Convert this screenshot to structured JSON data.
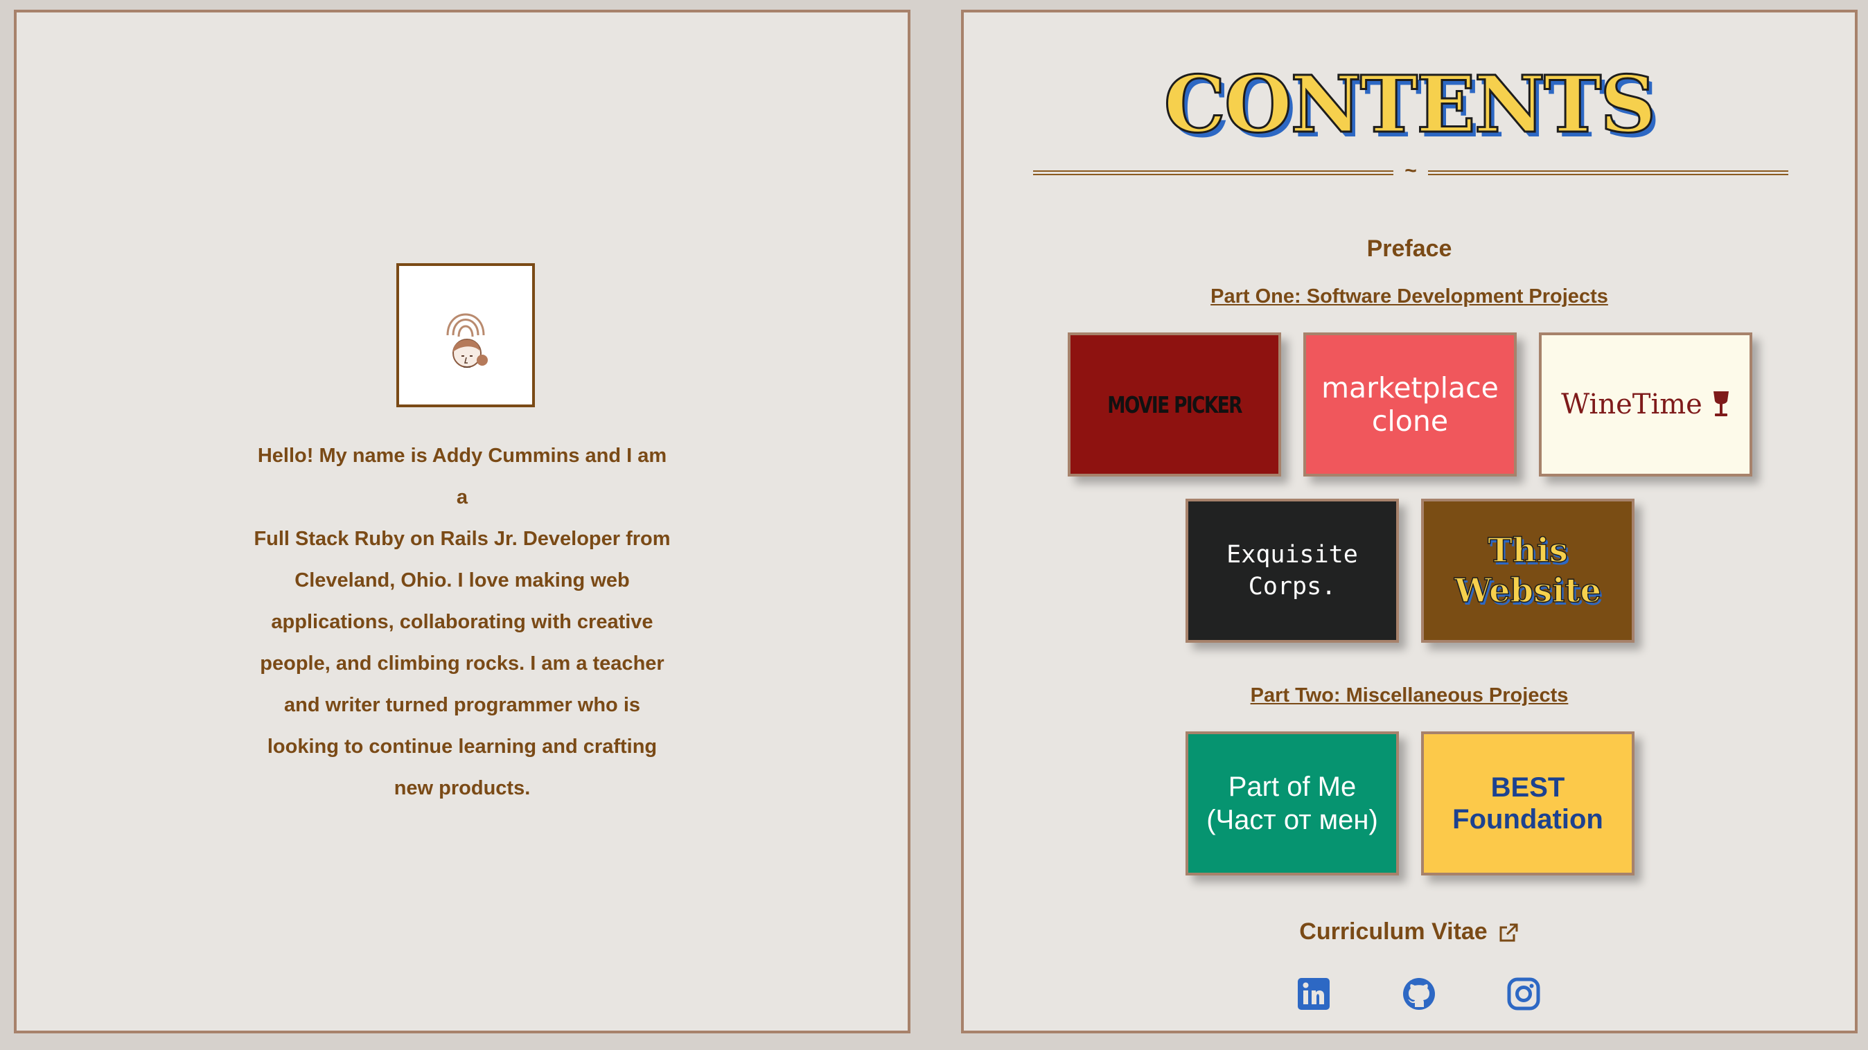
{
  "bio": {
    "lines": [
      "Hello! My name is Addy Cummins and I am a",
      "Full Stack Ruby on Rails Jr. Developer from",
      "Cleveland, Ohio. I love making web",
      "applications, collaborating with creative",
      "people, and climbing rocks. I am a teacher",
      "and writer turned programmer who is",
      "looking to continue learning and crafting",
      "new products."
    ],
    "avatar_icon": "face-with-rainbow-illustration"
  },
  "contents": {
    "title": "CONTENTS",
    "divider": "~",
    "preface": "Preface",
    "part_one": "Part One: Software Development Projects",
    "part_two": "Part Two: Miscellaneous Projects",
    "projects": {
      "movie_picker": "MOVIE PICKER",
      "marketplace_line1": "marketplace",
      "marketplace_line2": "clone",
      "winetime": "WineTime",
      "exquisite_line1": "Exquisite",
      "exquisite_line2": "Corps.",
      "website_line1": "This",
      "website_line2": "Website"
    },
    "misc": {
      "part_of_me_line1": "Part of Me",
      "part_of_me_line2": "(Част от мен)",
      "best_line1": "BEST",
      "best_line2": "Foundation"
    },
    "cv": "Curriculum Vitae",
    "social_icons": [
      "linkedin-icon",
      "github-icon",
      "instagram-icon"
    ]
  },
  "colors": {
    "page_bg": "#e8e5e1",
    "border": "#a7826b",
    "text_brown": "#7a4a16",
    "title_yellow": "#f6d04d",
    "title_shadow_blue": "#2d68c4",
    "icon_blue": "#2d68c4"
  }
}
